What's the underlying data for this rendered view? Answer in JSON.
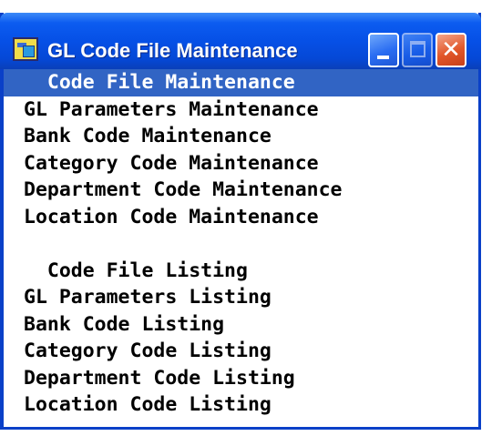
{
  "window": {
    "title": "GL Code File Maintenance",
    "icon": "app-icon",
    "controls": {
      "minimize": "minimize-icon",
      "maximize": "maximize-icon",
      "close": "close-icon"
    }
  },
  "menu": {
    "maintenance_group": {
      "header": "Code File Maintenance",
      "items": [
        "GL Parameters Maintenance",
        "Bank Code Maintenance",
        "Category Code Maintenance",
        "Department Code Maintenance",
        "Location Code Maintenance"
      ]
    },
    "listing_group": {
      "header": "Code File Listing",
      "items": [
        "GL Parameters Listing",
        "Bank Code Listing",
        "Category Code Listing",
        "Department Code Listing",
        "Location Code Listing"
      ]
    },
    "selected": "Code File Maintenance"
  },
  "colors": {
    "titlebar": "#0650e6",
    "selection": "#3164c4",
    "close_button": "#e2572a"
  }
}
